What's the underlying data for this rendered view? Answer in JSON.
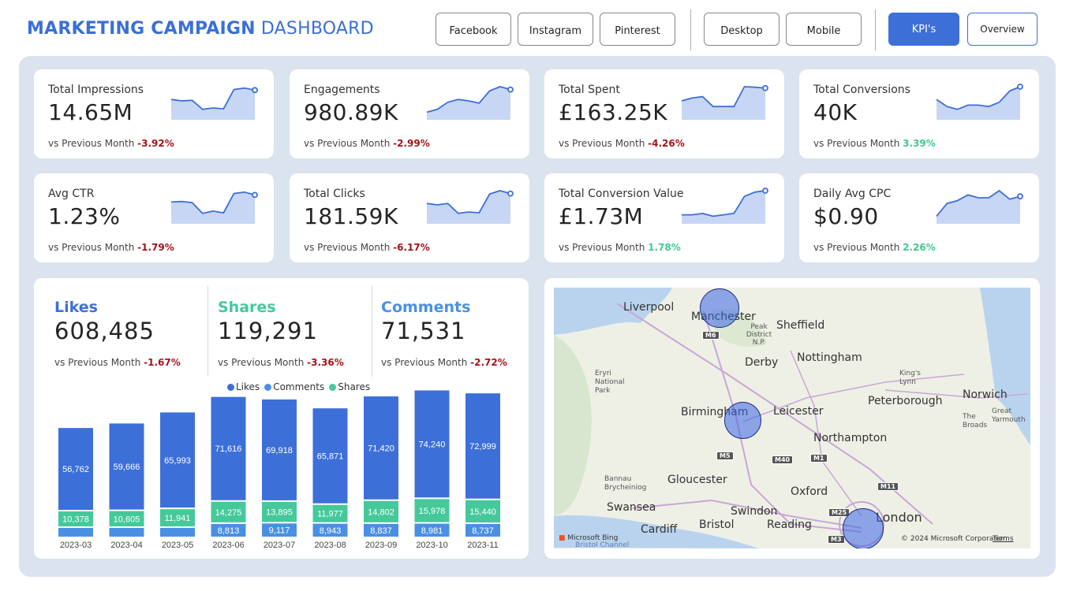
{
  "header": {
    "title_bold": "MARKETING CAMPAIGN",
    "title_light": "DASHBOARD",
    "platform_buttons": [
      "Facebook",
      "Instagram",
      "Pinterest"
    ],
    "device_buttons": [
      "Desktop",
      "Mobile"
    ],
    "kpis_button": "KPI's",
    "overview_button": "Overview"
  },
  "kpis": [
    {
      "label": "Total Impressions",
      "value": "14.65M",
      "cmp_label": "vs Previous Month",
      "delta": "-3.92%",
      "trend": "neg",
      "spark": [
        0.55,
        0.5,
        0.52,
        0.2,
        0.25,
        0.22,
        0.9,
        0.95,
        0.88
      ]
    },
    {
      "label": "Engagements",
      "value": "980.89K",
      "cmp_label": "vs Previous Month",
      "delta": "-2.99%",
      "trend": "neg",
      "spark": [
        0.1,
        0.2,
        0.45,
        0.55,
        0.5,
        0.42,
        0.85,
        1.0,
        0.9
      ]
    },
    {
      "label": "Total Spent",
      "value": "£163.25K",
      "cmp_label": "vs Previous Month",
      "delta": "-4.26%",
      "trend": "neg",
      "spark": [
        0.5,
        0.6,
        0.65,
        0.3,
        0.3,
        0.3,
        1.0,
        0.98,
        0.95
      ]
    },
    {
      "label": "Total Conversions",
      "value": "40K",
      "cmp_label": "vs Previous Month",
      "delta": "3.39%",
      "trend": "pos",
      "spark": [
        0.55,
        0.3,
        0.2,
        0.35,
        0.35,
        0.3,
        0.45,
        0.85,
        1.0
      ]
    },
    {
      "label": "Avg CTR",
      "value": "1.23%",
      "cmp_label": "vs Previous Month",
      "delta": "-1.79%",
      "trend": "neg",
      "spark": [
        0.6,
        0.62,
        0.58,
        0.2,
        0.28,
        0.22,
        0.9,
        0.95,
        0.85
      ]
    },
    {
      "label": "Total Clicks",
      "value": "181.59K",
      "cmp_label": "vs Previous Month",
      "delta": "-6.17%",
      "trend": "neg",
      "spark": [
        0.55,
        0.5,
        0.55,
        0.2,
        0.25,
        0.22,
        0.88,
        1.0,
        0.9
      ]
    },
    {
      "label": "Total Conversion Value",
      "value": "£1.73M",
      "cmp_label": "vs Previous Month",
      "delta": "1.78%",
      "trend": "pos",
      "spark": [
        0.15,
        0.15,
        0.2,
        0.1,
        0.15,
        0.2,
        0.8,
        0.95,
        1.0
      ]
    },
    {
      "label": "Daily Avg CPC",
      "value": "$0.90",
      "cmp_label": "vs Previous Month",
      "delta": "2.26%",
      "trend": "pos",
      "spark": [
        0.1,
        0.55,
        0.65,
        0.85,
        0.75,
        0.75,
        1.0,
        0.7,
        0.8
      ]
    }
  ],
  "engagement": [
    {
      "name": "Likes",
      "value": "608,485",
      "cmp_label": "vs Previous Month",
      "delta": "-1.67%",
      "color": "#3d6fd8"
    },
    {
      "name": "Shares",
      "value": "119,291",
      "cmp_label": "vs Previous Month",
      "delta": "-3.36%",
      "color": "#45c99a"
    },
    {
      "name": "Comments",
      "value": "71,531",
      "cmp_label": "vs Previous Month",
      "delta": "-2.72%",
      "color": "#4a90e2"
    }
  ],
  "legend": [
    {
      "name": "Likes",
      "color": "#3d6fd8"
    },
    {
      "name": "Comments",
      "color": "#4a90e2"
    },
    {
      "name": "Shares",
      "color": "#45c99a"
    }
  ],
  "chart_data": {
    "type": "bar",
    "stacked": true,
    "categories": [
      "2023-03",
      "2023-04",
      "2023-05",
      "2023-06",
      "2023-07",
      "2023-08",
      "2023-09",
      "2023-10",
      "2023-11"
    ],
    "series": [
      {
        "name": "Comments",
        "color": "#4a90e2",
        "values": [
          null,
          null,
          null,
          8813,
          9117,
          8943,
          8837,
          8981,
          8737
        ]
      },
      {
        "name": "Shares",
        "color": "#45c99a",
        "values": [
          10378,
          10605,
          11941,
          14275,
          13895,
          11977,
          14802,
          15978,
          15440
        ]
      },
      {
        "name": "Likes",
        "color": "#3d6fd8",
        "values": [
          56762,
          59666,
          65993,
          71616,
          69918,
          65871,
          71420,
          74240,
          72999
        ]
      }
    ],
    "legend_position": "top-center"
  },
  "map": {
    "labels": {
      "liverpool": "Liverpool",
      "manchester": "Manchester",
      "sheffield": "Sheffield",
      "peak": "Peak District N.P.",
      "derby": "Derby",
      "nottingham": "Nottingham",
      "kings_lynn": "King's Lynn",
      "norwich": "Norwich",
      "eryri": "Eryri National Park",
      "birmingham": "Birmingham",
      "leicester": "Leicester",
      "peterborough": "Peterborough",
      "the_broads": "The Broads",
      "great_yarmouth": "Great Yarmouth",
      "northampton": "Northampton",
      "gloucester": "Gloucester",
      "bannau": "Bannau Brycheiniog",
      "oxford": "Oxford",
      "swansea": "Swansea",
      "swindon": "Swindon",
      "london": "London",
      "cardiff": "Cardiff",
      "bristol": "Bristol",
      "reading": "Reading",
      "bristol_channel": "Bristol Channel"
    },
    "roads": [
      "M6",
      "M5",
      "M40",
      "M1",
      "M11",
      "M25",
      "M3"
    ],
    "bing": "Microsoft Bing",
    "copyright": "© 2024 Microsoft Corporation",
    "terms": "Terms"
  }
}
